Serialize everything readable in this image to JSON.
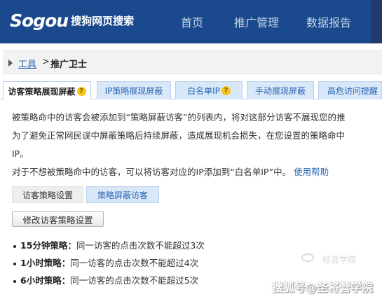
{
  "header": {
    "logo_text": "Sogou",
    "logo_sub": "搜狗网页搜索",
    "nav": [
      "首页",
      "推广管理",
      "数据报告"
    ]
  },
  "breadcrumb": {
    "link": "工具",
    "separator": ">",
    "current": "推广卫士"
  },
  "tabs": [
    {
      "label": "访客策略展现屏蔽",
      "has_help": true
    },
    {
      "label": "IP策略展现屏蔽",
      "has_help": false
    },
    {
      "label": "白名单IP",
      "has_help": true
    },
    {
      "label": "手动展现屏蔽",
      "has_help": false
    },
    {
      "label": "高危访问提醒",
      "has_help": false
    }
  ],
  "help_glyph": "?",
  "description": {
    "line1": "被策略命中的访客会被添加到“策略屏蔽访客”的列表内，将对这部分访客不展现您的推",
    "line2": "为了避免正常网民误中屏蔽策略后持续屏蔽，造成展现机会损失，在您设置的策略命中",
    "line3": "IP。",
    "line4": "对于不想被策略命中的访客，可以将访客对应的IP添加到“白名单IP”中。",
    "help_link": "使用帮助"
  },
  "subtabs": [
    "访客策略设置",
    "策略屏蔽访客"
  ],
  "modify_button": "修改访客策略设置",
  "rules": [
    {
      "name": "15分钟策略：",
      "text": "同一访客的点击次数不能超过3次"
    },
    {
      "name": "1小时策略：",
      "text": "同一访客的点击次数不能超过4次"
    },
    {
      "name": "6小时策略：",
      "text": "同一访客的点击次数不能超过5次"
    }
  ],
  "watermark": "搜狐号@圣将营学院",
  "watermark_faint": "经营学院",
  "colors": {
    "header_bg": "#1a4a8d",
    "link": "#2b66b3",
    "tab_bg": "#d9e8f8"
  }
}
